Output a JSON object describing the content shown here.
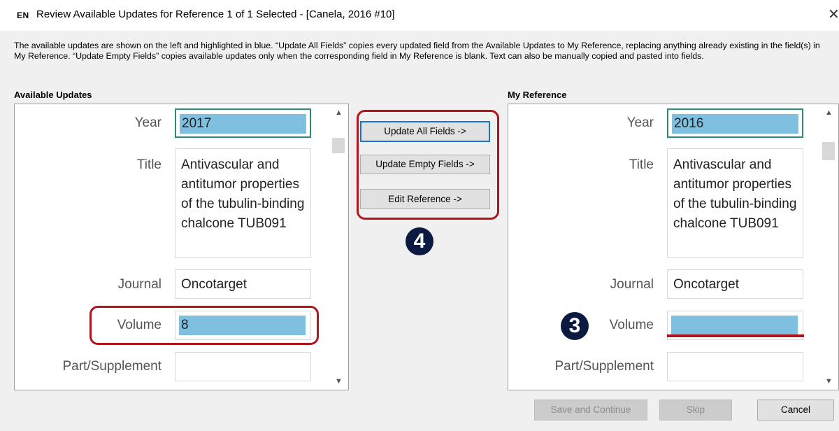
{
  "window": {
    "app_badge": "EN",
    "title": "Review Available Updates for Reference 1 of 1 Selected - [Canela, 2016 #10]",
    "close_glyph": "✕"
  },
  "description": "The available updates are shown on the left and highlighted in blue. “Update All Fields” copies every updated field from the Available Updates to My Reference, replacing anything already existing in the field(s) in My Reference. “Update Empty Fields” copies available updates only when the corresponding field in My Reference is blank. Text can also be manually copied and pasted into fields.",
  "available": {
    "heading": "Available Updates",
    "fields": {
      "year": {
        "label": "Year",
        "value": "2017"
      },
      "title": {
        "label": "Title",
        "value": "Antivascular and antitumor properties of the tubulin-binding chalcone TUB091"
      },
      "journal": {
        "label": "Journal",
        "value": "Oncotarget"
      },
      "volume": {
        "label": "Volume",
        "value": "8"
      },
      "part": {
        "label": "Part/Supplement",
        "value": ""
      }
    }
  },
  "mine": {
    "heading": "My Reference",
    "fields": {
      "year": {
        "label": "Year",
        "value": "2016"
      },
      "title": {
        "label": "Title",
        "value": "Antivascular and antitumor properties of the tubulin-binding chalcone TUB091"
      },
      "journal": {
        "label": "Journal",
        "value": "Oncotarget"
      },
      "volume": {
        "label": "Volume",
        "value": ""
      },
      "part": {
        "label": "Part/Supplement",
        "value": ""
      }
    }
  },
  "actions": {
    "update_all": "Update All Fields ->",
    "update_empty": "Update Empty Fields ->",
    "edit_reference": "Edit Reference ->"
  },
  "footer": {
    "save_continue": "Save and Continue",
    "skip": "Skip",
    "cancel": "Cancel"
  },
  "annotations": {
    "badge_3": "3",
    "badge_4": "4"
  },
  "colors": {
    "highlight": "#7fbfdf",
    "annotation_red": "#b0141c",
    "focus_teal": "#2b8a78",
    "badge_navy": "#0b1a40"
  }
}
